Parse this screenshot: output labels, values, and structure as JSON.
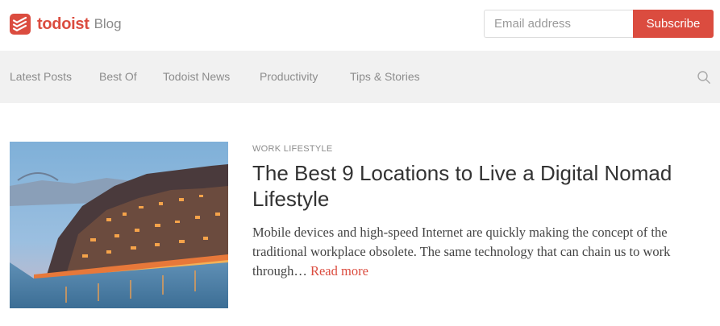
{
  "header": {
    "logo_word": "todoist",
    "logo_sub": "Blog",
    "email_placeholder": "Email address",
    "subscribe_label": "Subscribe",
    "brand_color": "#db4c3f"
  },
  "nav": {
    "items": [
      {
        "label": "Latest Posts"
      },
      {
        "label": "Best Of"
      },
      {
        "label": "Todoist News"
      },
      {
        "label": "Productivity"
      },
      {
        "label": "Tips & Stories"
      }
    ],
    "search_icon": "search-icon"
  },
  "article": {
    "category": "WORK LIFESTYLE",
    "title": "The Best 9 Locations to Live a Digital Nomad Lifestyle",
    "excerpt": "Mobile devices and high-speed Internet are quickly making the concept of the traditional workplace obsolete. The same technology that can chain us to work through…",
    "read_more": "Read more",
    "thumbnail": "city-night-riverside-image"
  }
}
